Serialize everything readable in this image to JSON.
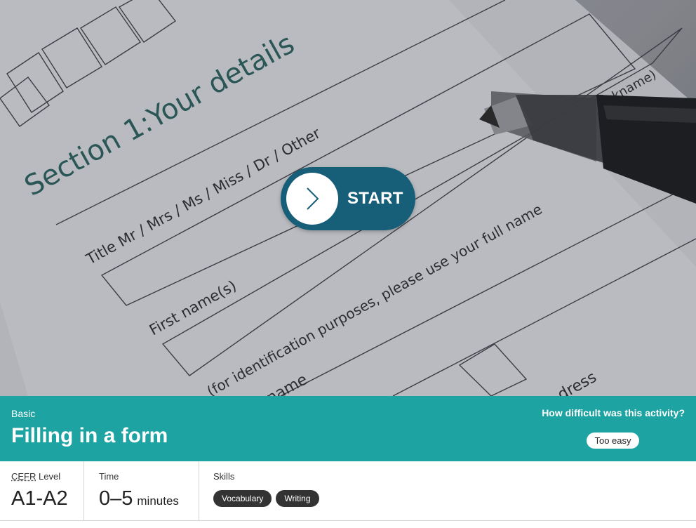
{
  "hero": {
    "image_alt_text_lines": {
      "section": "Section 1:Your details",
      "title_line": "Title Mr / Mrs / Ms / Miss / Dr / Other",
      "first_name": "First name(s)",
      "note": "(for identification purposes, please use your full name",
      "nickname": "ckname)",
      "name": "name",
      "address": "dress"
    },
    "start_label": "START"
  },
  "activity": {
    "level": "Basic",
    "title": "Filling in a form",
    "difficulty_question": "How difficult was this activity?",
    "difficulty_option": "Too easy"
  },
  "details": {
    "cefr_abbr": "CEFR",
    "cefr_suffix": " Level",
    "cefr_value": "A1-A2",
    "time_label": "Time",
    "time_value": "0–5",
    "time_unit": "minutes",
    "skills_label": "Skills",
    "skills": [
      "Vocabulary",
      "Writing"
    ]
  },
  "colors": {
    "band": "#1ca3a2",
    "start_button": "#175e78",
    "tag": "#333333"
  }
}
